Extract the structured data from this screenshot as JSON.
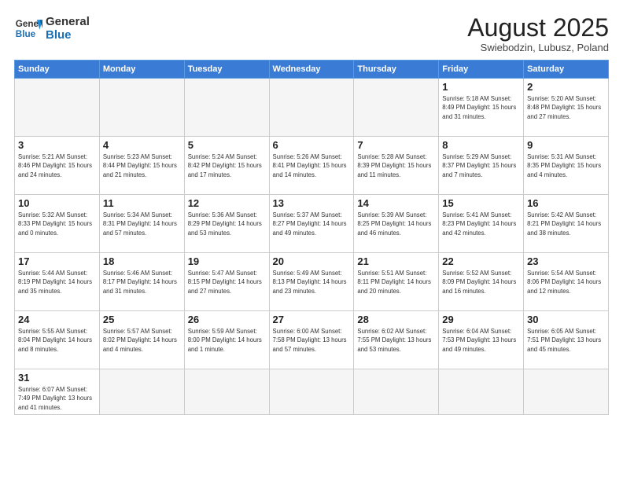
{
  "header": {
    "logo_general": "General",
    "logo_blue": "Blue",
    "title": "August 2025",
    "subtitle": "Swiebodzin, Lubusz, Poland"
  },
  "days_of_week": [
    "Sunday",
    "Monday",
    "Tuesday",
    "Wednesday",
    "Thursday",
    "Friday",
    "Saturday"
  ],
  "weeks": [
    [
      {
        "num": "",
        "info": ""
      },
      {
        "num": "",
        "info": ""
      },
      {
        "num": "",
        "info": ""
      },
      {
        "num": "",
        "info": ""
      },
      {
        "num": "",
        "info": ""
      },
      {
        "num": "1",
        "info": "Sunrise: 5:18 AM\nSunset: 8:49 PM\nDaylight: 15 hours\nand 31 minutes."
      },
      {
        "num": "2",
        "info": "Sunrise: 5:20 AM\nSunset: 8:48 PM\nDaylight: 15 hours\nand 27 minutes."
      }
    ],
    [
      {
        "num": "3",
        "info": "Sunrise: 5:21 AM\nSunset: 8:46 PM\nDaylight: 15 hours\nand 24 minutes."
      },
      {
        "num": "4",
        "info": "Sunrise: 5:23 AM\nSunset: 8:44 PM\nDaylight: 15 hours\nand 21 minutes."
      },
      {
        "num": "5",
        "info": "Sunrise: 5:24 AM\nSunset: 8:42 PM\nDaylight: 15 hours\nand 17 minutes."
      },
      {
        "num": "6",
        "info": "Sunrise: 5:26 AM\nSunset: 8:41 PM\nDaylight: 15 hours\nand 14 minutes."
      },
      {
        "num": "7",
        "info": "Sunrise: 5:28 AM\nSunset: 8:39 PM\nDaylight: 15 hours\nand 11 minutes."
      },
      {
        "num": "8",
        "info": "Sunrise: 5:29 AM\nSunset: 8:37 PM\nDaylight: 15 hours\nand 7 minutes."
      },
      {
        "num": "9",
        "info": "Sunrise: 5:31 AM\nSunset: 8:35 PM\nDaylight: 15 hours\nand 4 minutes."
      }
    ],
    [
      {
        "num": "10",
        "info": "Sunrise: 5:32 AM\nSunset: 8:33 PM\nDaylight: 15 hours\nand 0 minutes."
      },
      {
        "num": "11",
        "info": "Sunrise: 5:34 AM\nSunset: 8:31 PM\nDaylight: 14 hours\nand 57 minutes."
      },
      {
        "num": "12",
        "info": "Sunrise: 5:36 AM\nSunset: 8:29 PM\nDaylight: 14 hours\nand 53 minutes."
      },
      {
        "num": "13",
        "info": "Sunrise: 5:37 AM\nSunset: 8:27 PM\nDaylight: 14 hours\nand 49 minutes."
      },
      {
        "num": "14",
        "info": "Sunrise: 5:39 AM\nSunset: 8:25 PM\nDaylight: 14 hours\nand 46 minutes."
      },
      {
        "num": "15",
        "info": "Sunrise: 5:41 AM\nSunset: 8:23 PM\nDaylight: 14 hours\nand 42 minutes."
      },
      {
        "num": "16",
        "info": "Sunrise: 5:42 AM\nSunset: 8:21 PM\nDaylight: 14 hours\nand 38 minutes."
      }
    ],
    [
      {
        "num": "17",
        "info": "Sunrise: 5:44 AM\nSunset: 8:19 PM\nDaylight: 14 hours\nand 35 minutes."
      },
      {
        "num": "18",
        "info": "Sunrise: 5:46 AM\nSunset: 8:17 PM\nDaylight: 14 hours\nand 31 minutes."
      },
      {
        "num": "19",
        "info": "Sunrise: 5:47 AM\nSunset: 8:15 PM\nDaylight: 14 hours\nand 27 minutes."
      },
      {
        "num": "20",
        "info": "Sunrise: 5:49 AM\nSunset: 8:13 PM\nDaylight: 14 hours\nand 23 minutes."
      },
      {
        "num": "21",
        "info": "Sunrise: 5:51 AM\nSunset: 8:11 PM\nDaylight: 14 hours\nand 20 minutes."
      },
      {
        "num": "22",
        "info": "Sunrise: 5:52 AM\nSunset: 8:09 PM\nDaylight: 14 hours\nand 16 minutes."
      },
      {
        "num": "23",
        "info": "Sunrise: 5:54 AM\nSunset: 8:06 PM\nDaylight: 14 hours\nand 12 minutes."
      }
    ],
    [
      {
        "num": "24",
        "info": "Sunrise: 5:55 AM\nSunset: 8:04 PM\nDaylight: 14 hours\nand 8 minutes."
      },
      {
        "num": "25",
        "info": "Sunrise: 5:57 AM\nSunset: 8:02 PM\nDaylight: 14 hours\nand 4 minutes."
      },
      {
        "num": "26",
        "info": "Sunrise: 5:59 AM\nSunset: 8:00 PM\nDaylight: 14 hours\nand 1 minute."
      },
      {
        "num": "27",
        "info": "Sunrise: 6:00 AM\nSunset: 7:58 PM\nDaylight: 13 hours\nand 57 minutes."
      },
      {
        "num": "28",
        "info": "Sunrise: 6:02 AM\nSunset: 7:55 PM\nDaylight: 13 hours\nand 53 minutes."
      },
      {
        "num": "29",
        "info": "Sunrise: 6:04 AM\nSunset: 7:53 PM\nDaylight: 13 hours\nand 49 minutes."
      },
      {
        "num": "30",
        "info": "Sunrise: 6:05 AM\nSunset: 7:51 PM\nDaylight: 13 hours\nand 45 minutes."
      }
    ],
    [
      {
        "num": "31",
        "info": "Sunrise: 6:07 AM\nSunset: 7:49 PM\nDaylight: 13 hours\nand 41 minutes."
      },
      {
        "num": "",
        "info": ""
      },
      {
        "num": "",
        "info": ""
      },
      {
        "num": "",
        "info": ""
      },
      {
        "num": "",
        "info": ""
      },
      {
        "num": "",
        "info": ""
      },
      {
        "num": "",
        "info": ""
      }
    ]
  ]
}
